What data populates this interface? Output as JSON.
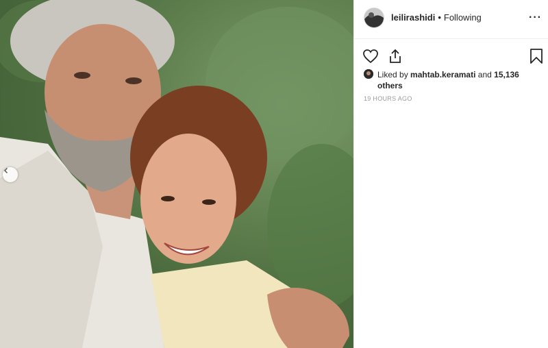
{
  "post": {
    "username": "leilirashidi",
    "separator": "•",
    "follow_status": "Following",
    "more_label": "···"
  },
  "likes": {
    "prefix": "Liked by",
    "liker": "mahtab.keramati",
    "conjunction": "and",
    "others": "15,136 others"
  },
  "timestamp": "19 HOURS AGO",
  "icons": [
    "heart-icon",
    "share-icon",
    "bookmark-icon",
    "chevron-left-icon",
    "more-icon"
  ],
  "colors": {
    "text": "#262626",
    "muted": "#999999",
    "border": "#efefef"
  }
}
